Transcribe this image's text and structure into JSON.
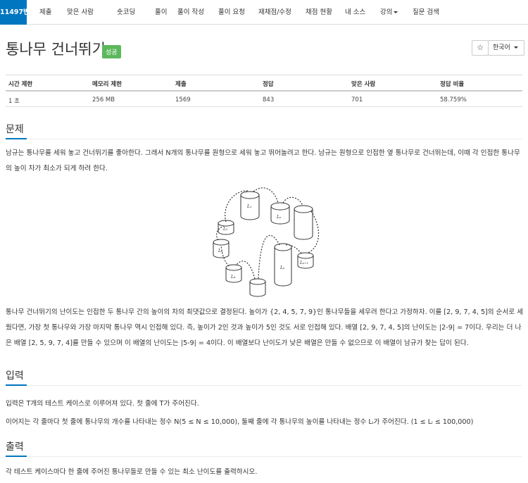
{
  "nav": {
    "items": [
      {
        "label": "11497번",
        "active": true
      },
      {
        "label": "제출"
      },
      {
        "label": "맞은 사람"
      },
      {
        "label": "숏코딩"
      },
      {
        "label": "풀이"
      },
      {
        "label": "풀이 작성"
      },
      {
        "label": "풀이 요청"
      },
      {
        "label": "재채점/수정"
      },
      {
        "label": "채점 현황"
      },
      {
        "label": "내 소스"
      },
      {
        "label": "강의",
        "dropdown": true
      },
      {
        "label": "질문 검색"
      }
    ]
  },
  "problem": {
    "title": "통나무 건너뛰기",
    "status_badge": "성공",
    "star_icon": "star-icon",
    "language": "한국어"
  },
  "info_table": {
    "headers": [
      "시간 제한",
      "메모리 제한",
      "제출",
      "정답",
      "맞은 사람",
      "정답 비율"
    ],
    "values": [
      "1 초",
      "256 MB",
      "1569",
      "843",
      "701",
      "58.759%"
    ]
  },
  "sections": {
    "problem_heading": "문제",
    "problem_text_1": "남규는 통나무를 세워 놓고 건너뛰기를 좋아한다. 그래서 N개의 통나무를 원형으로 세워 놓고 뛰어놀려고 한다. 남규는 원형으로 인접한 옆 통나무로 건너뛰는데, 이때 각 인접한 통나무의 높이 차가 최소가 되게 하려 한다.",
    "problem_text_2": "통나무 건너뛰기의 난이도는 인접한 두 통나무 간의 높이의 차의 최댓값으로 결정된다. 높이가 {2, 4, 5, 7, 9}인 통나무들을 세우려 한다고 가정하자. 이를 [2, 9, 7, 4, 5]의 순서로 세웠다면, 가장 첫 통나무와 가장 마지막 통나무 역시 인접해 있다. 즉, 높이가 2인 것과 높이가 5인 것도 서로 인접해 있다. 배열 [2, 9, 7, 4, 5]의 난이도는 |2-9| = 7이다. 우리는 더 나은 배열 [2, 5, 9, 7, 4]를 만들 수 있으며 이 배열의 난이도는 |5-9| = 4이다. 이 배열보다 난이도가 낮은 배열은 만들 수 없으므로 이 배열이 남규가 찾는 답이 된다.",
    "input_heading": "입력",
    "input_text_1": "입력은 T개의 테스트 케이스로 이루어져 있다. 첫 줄에 T가 주어진다.",
    "input_text_2": "이어지는 각 줄마다 첫 줄에 통나무의 개수를 나타내는 정수 N(5 ≤ N ≤ 10,000), 둘째 줄에 각 통나무의 높이를 나타내는 정수 Lᵢ가 주어진다. (1 ≤ Lᵢ ≤ 100,000)",
    "output_heading": "출력",
    "output_text_1": "각 테스트 케이스마다 한 줄에 주어진 통나무들로 만들 수 있는 최소 난이도를 출력하시오."
  },
  "figure": {
    "labels": [
      "L₁",
      "L₂",
      "L₃",
      "L₄",
      "Lₙ",
      "Lₙ₊₁",
      "Lₙ"
    ]
  }
}
